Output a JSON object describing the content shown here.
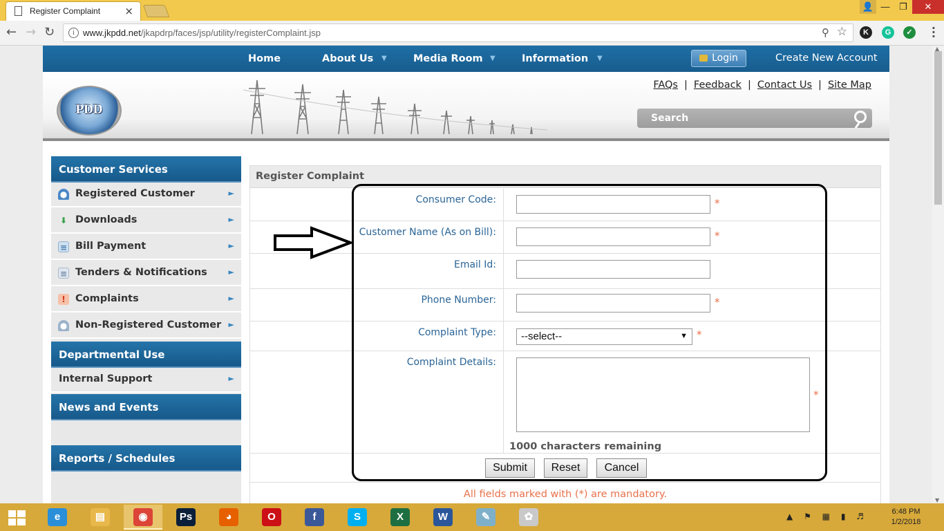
{
  "browser": {
    "tab_title": "Register Complaint",
    "tab_close": "×",
    "url_host": "www.jkpdd.net",
    "url_path": "/jkapdrp/faces/jsp/utility/registerComplaint.jsp",
    "extensions": [
      {
        "label": "K",
        "color": "#222222"
      },
      {
        "label": "G",
        "color": "#15c39a"
      },
      {
        "label": "✓",
        "color": "#1e8e3e"
      }
    ]
  },
  "site": {
    "nav": {
      "home": "Home",
      "about": "About Us",
      "media": "Media Room",
      "information": "Information",
      "login": "Login",
      "create_account": "Create New Account"
    },
    "logo_text": "PDD",
    "top_links": {
      "faqs": "FAQs",
      "feedback": "Feedback",
      "contact": "Contact Us",
      "sitemap": "Site Map",
      "separator": "|"
    },
    "search_placeholder": "Search"
  },
  "sidebar": {
    "sections": [
      {
        "title": "Customer Services"
      },
      {
        "title": "Departmental Use"
      },
      {
        "title": "News and Events"
      },
      {
        "title": "Reports / Schedules"
      }
    ],
    "items": [
      {
        "label": "Registered Customer",
        "icon": "user-icon"
      },
      {
        "label": "Downloads",
        "icon": "download-icon"
      },
      {
        "label": "Bill Payment",
        "icon": "bill-icon"
      },
      {
        "label": "Tenders & Notifications",
        "icon": "document-icon"
      },
      {
        "label": "Complaints",
        "icon": "alert-icon"
      },
      {
        "label": "Non-Registered Customer",
        "icon": "user-icon"
      }
    ],
    "internal_support": "Internal Support"
  },
  "form": {
    "title": "Register Complaint",
    "consumer_code_label": "Consumer Code:",
    "customer_name_label": "Customer Name (As on Bill):",
    "email_label": "Email Id:",
    "phone_label": "Phone Number:",
    "complaint_type_label": "Complaint Type:",
    "complaint_type_value": "--select--",
    "complaint_details_label": "Complaint Details:",
    "chars_remaining": "1000 characters remaining",
    "required_marker": "*",
    "submit": "Submit",
    "reset": "Reset",
    "cancel": "Cancel",
    "mandatory_note": "All fields marked with (*) are mandatory."
  },
  "taskbar": {
    "time": "6:48 PM",
    "date": "1/2/2018",
    "apps": [
      {
        "name": "ie",
        "label": "e",
        "color": "#2a8fd8"
      },
      {
        "name": "explorer",
        "label": "▤",
        "color": "#e8b84a"
      },
      {
        "name": "chrome",
        "label": "◉",
        "color": "#db4437"
      },
      {
        "name": "photoshop",
        "label": "Ps",
        "color": "#0b1f3a"
      },
      {
        "name": "firefox",
        "label": "◕",
        "color": "#e66000"
      },
      {
        "name": "opera",
        "label": "O",
        "color": "#cc0f16"
      },
      {
        "name": "facebook",
        "label": "f",
        "color": "#3b5998"
      },
      {
        "name": "skype",
        "label": "S",
        "color": "#00aff0"
      },
      {
        "name": "excel",
        "label": "X",
        "color": "#1d6f42"
      },
      {
        "name": "word",
        "label": "W",
        "color": "#2b579a"
      },
      {
        "name": "notes",
        "label": "✎",
        "color": "#7fb0c9"
      },
      {
        "name": "paint",
        "label": "✿",
        "color": "#c9c9c9"
      }
    ]
  }
}
